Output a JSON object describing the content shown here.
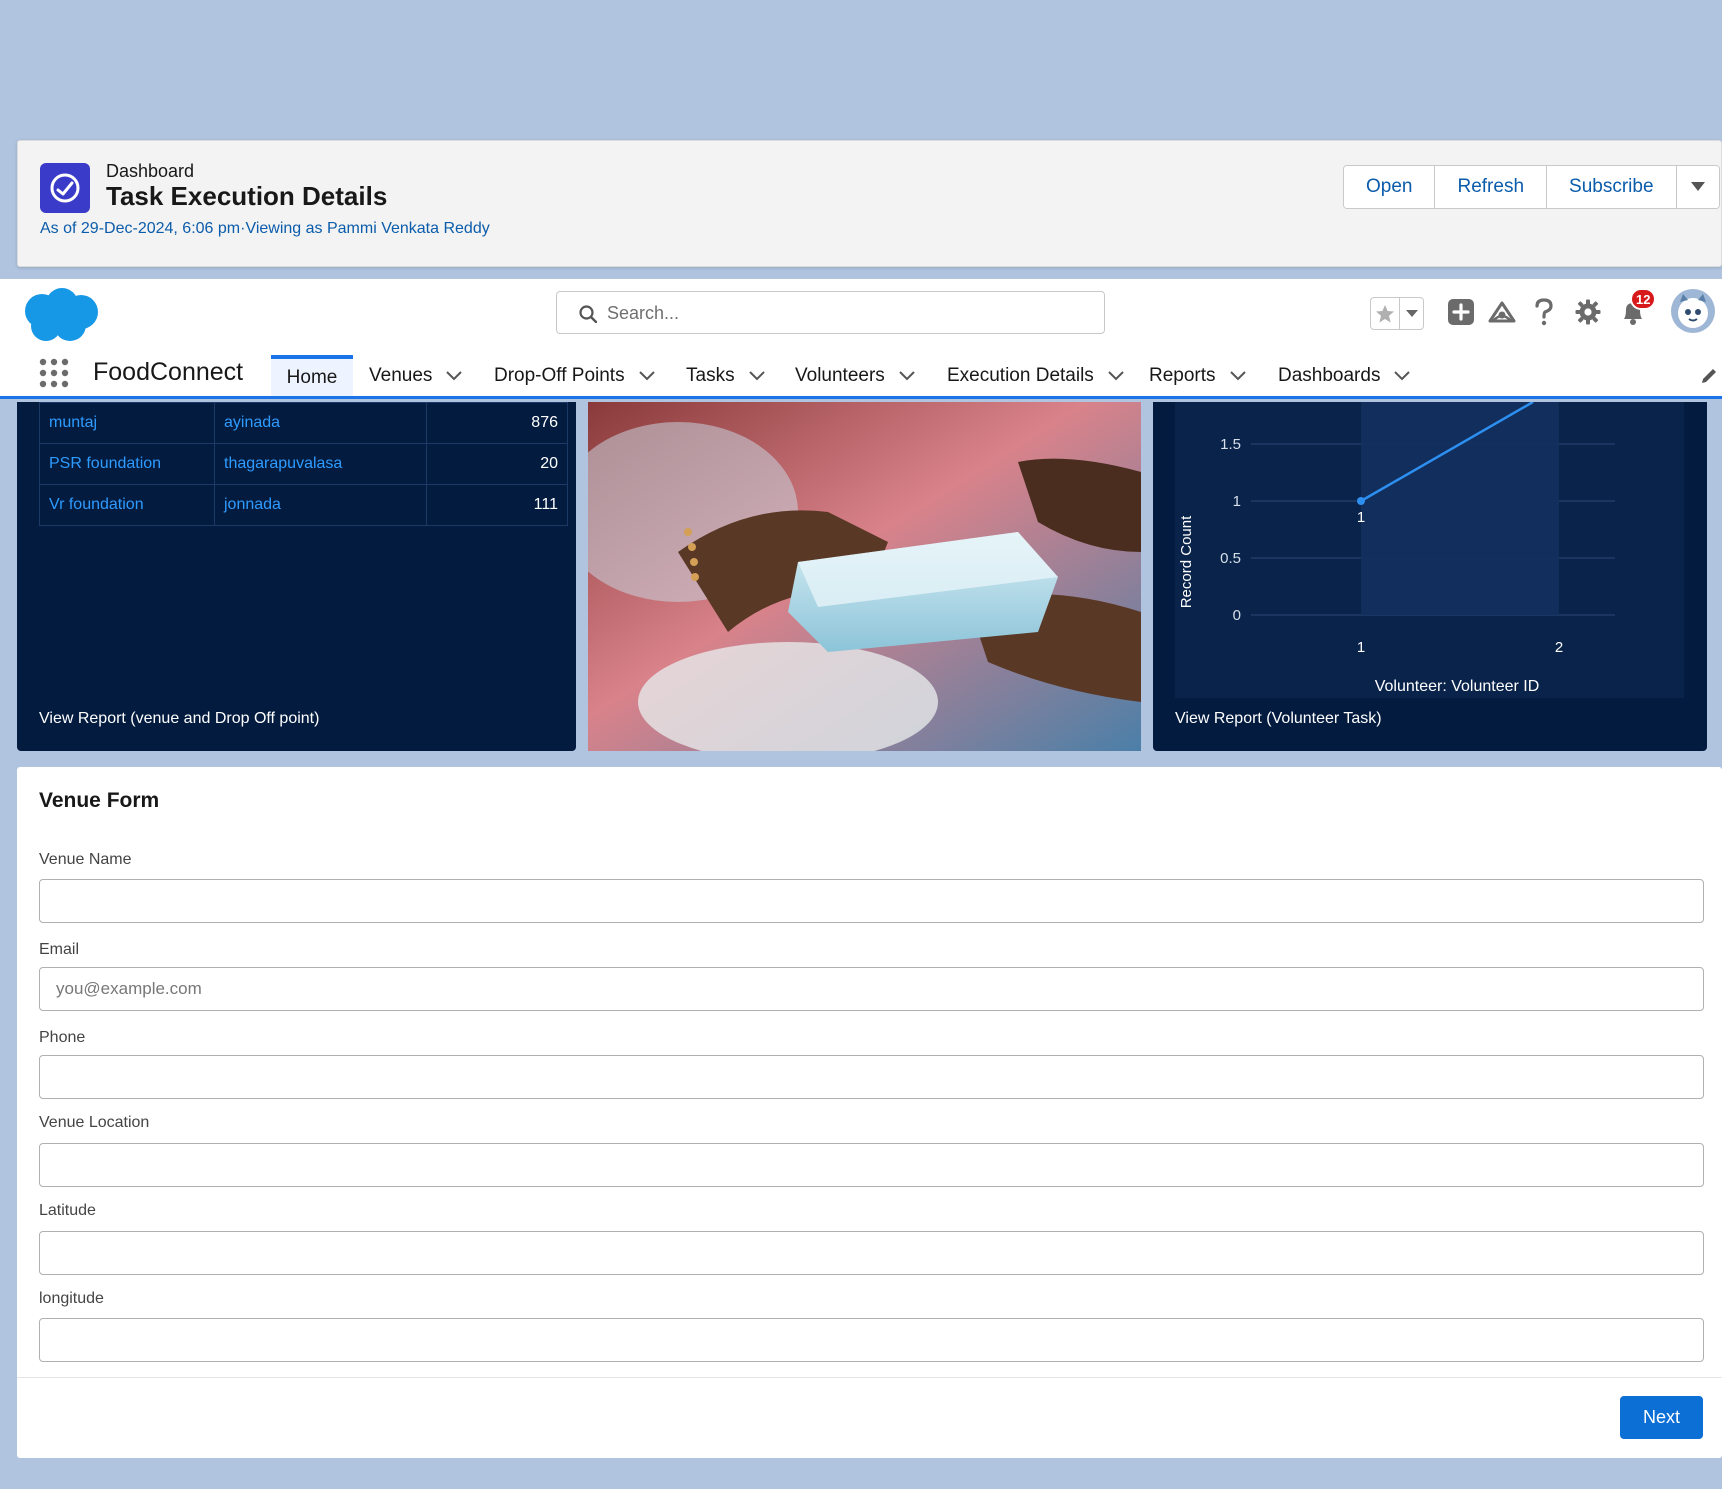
{
  "dashboard": {
    "kicker": "Dashboard",
    "title": "Task Execution Details",
    "subtitle": "As of 29-Dec-2024, 6:06 pm·Viewing as Pammi Venkata Reddy",
    "actions": {
      "open": "Open",
      "refresh": "Refresh",
      "subscribe": "Subscribe"
    },
    "colors": {
      "icon_bg": "#3a3bc9",
      "link": "#0b5cab"
    }
  },
  "topbar": {
    "search_placeholder": "Search...",
    "notification_count": "12",
    "icons": [
      "salesforce-cloud-logo",
      "search-icon",
      "favorites-star-icon",
      "favorites-dropdown-icon",
      "global-add-icon",
      "trailhead-icon",
      "help-icon",
      "setup-gear-icon",
      "notifications-bell-icon",
      "user-avatar"
    ]
  },
  "nav": {
    "app_name": "FoodConnect",
    "items": [
      {
        "label": "Home",
        "active": true
      },
      {
        "label": "Venues"
      },
      {
        "label": "Drop-Off Points"
      },
      {
        "label": "Tasks"
      },
      {
        "label": "Volunteers"
      },
      {
        "label": "Execution Details"
      },
      {
        "label": "Reports"
      },
      {
        "label": "Dashboards"
      }
    ],
    "accent": "#1b73e8"
  },
  "venue_table": {
    "rows": [
      {
        "venue": "muntaj",
        "drop_off": "ayinada",
        "value": "876"
      },
      {
        "venue": "PSR foundation",
        "drop_off": "thagarapuvalasa",
        "value": "20"
      },
      {
        "venue": "Vr foundation",
        "drop_off": "jonnada",
        "value": "111"
      }
    ],
    "view_report": "View Report (venue and Drop Off point)"
  },
  "volunteer_chart": {
    "view_report": "View Report (Volunteer Task)"
  },
  "chart_data": {
    "type": "line",
    "x": [
      1,
      2
    ],
    "y": [
      1,
      2
    ],
    "point_labels": [
      "1",
      ""
    ],
    "xlabel": "Volunteer: Volunteer ID",
    "ylabel": "Record Count",
    "y_ticks": [
      "0",
      "0.5",
      "1",
      "1.5"
    ],
    "x_ticks": [
      "1",
      "2"
    ],
    "line_color": "#2d8ff0"
  },
  "form": {
    "title": "Venue Form",
    "fields": {
      "venue_name": {
        "label": "Venue Name",
        "value": "",
        "placeholder": ""
      },
      "email": {
        "label": "Email",
        "value": "",
        "placeholder": "you@example.com"
      },
      "phone": {
        "label": "Phone",
        "value": "",
        "placeholder": ""
      },
      "venue_location": {
        "label": "Venue Location",
        "value": "",
        "placeholder": ""
      },
      "latitude": {
        "label": "Latitude",
        "value": "",
        "placeholder": ""
      },
      "longitude": {
        "label": "longitude",
        "value": "",
        "placeholder": ""
      }
    },
    "next_label": "Next"
  }
}
